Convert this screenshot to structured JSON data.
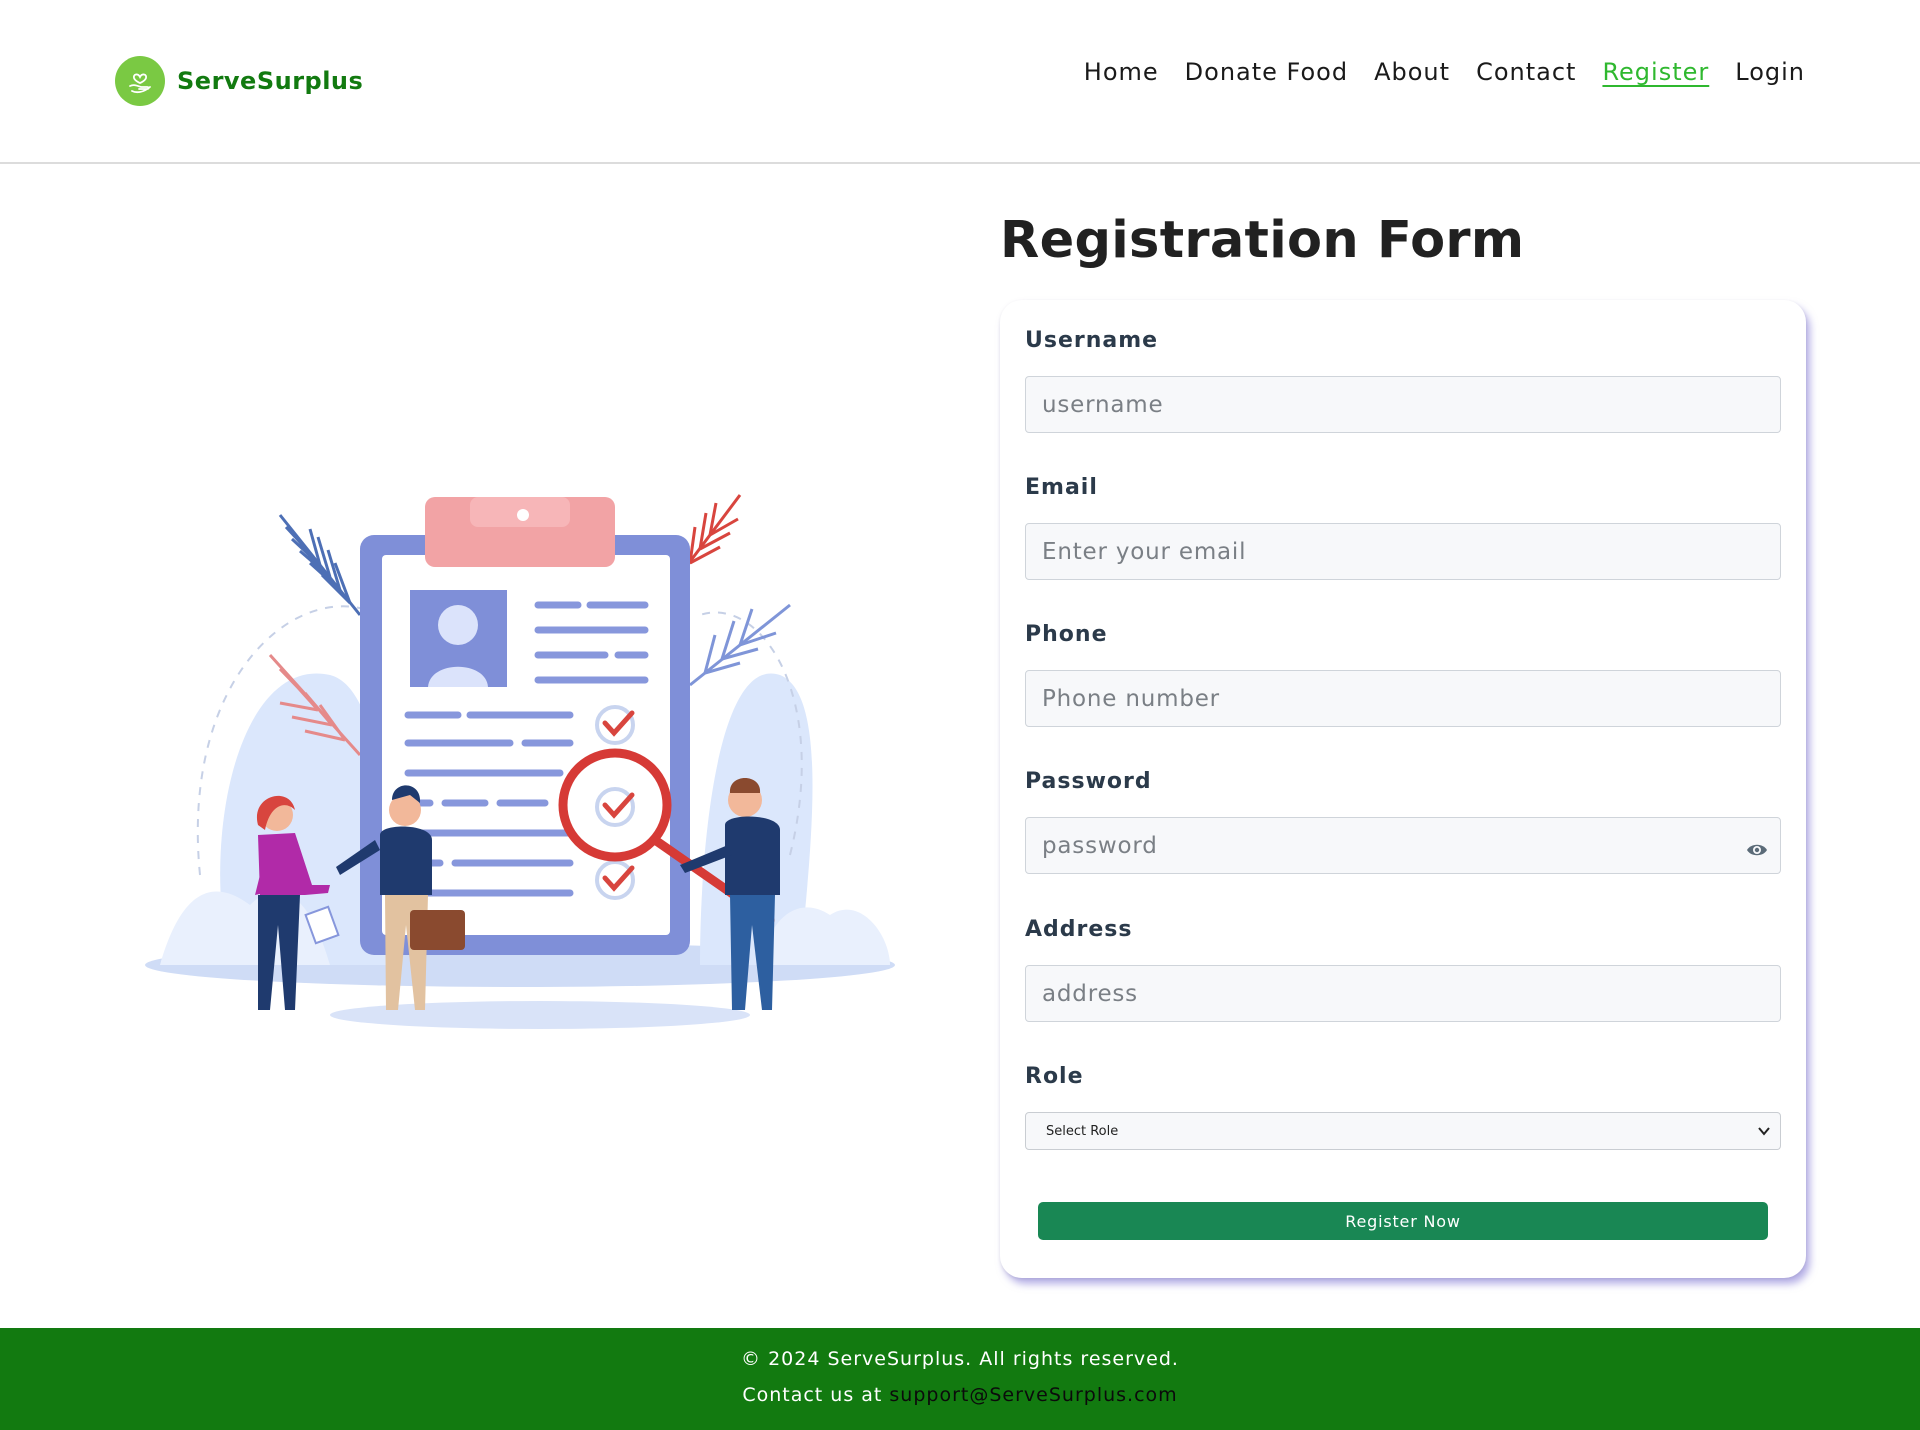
{
  "brand": {
    "name": "ServeSurplus",
    "color": "#127a10",
    "logo_bg": "#7ac943",
    "logo_icon": "heart-in-hand-icon"
  },
  "nav": {
    "items": [
      {
        "label": "Home",
        "active": false
      },
      {
        "label": "Donate Food",
        "active": false
      },
      {
        "label": "About",
        "active": false
      },
      {
        "label": "Contact",
        "active": false
      },
      {
        "label": "Register",
        "active": true
      },
      {
        "label": "Login",
        "active": false
      }
    ],
    "active_color": "#2fb82f"
  },
  "form": {
    "title": "Registration Form",
    "fields": {
      "username": {
        "label": "Username",
        "placeholder": "username"
      },
      "email": {
        "label": "Email",
        "placeholder": "Enter your email"
      },
      "phone": {
        "label": "Phone",
        "placeholder": "Phone number"
      },
      "password": {
        "label": "Password",
        "placeholder": "password",
        "toggle_icon": "eye-icon"
      },
      "address": {
        "label": "Address",
        "placeholder": "address"
      },
      "role": {
        "label": "Role",
        "selected": "Select Role"
      }
    },
    "submit_label": "Register Now",
    "submit_color": "#198754"
  },
  "footer": {
    "copyright": "© 2024 ServeSurplus. All rights reserved.",
    "contact_prefix": "Contact us at",
    "contact_email": "support@ServeSurplus.com",
    "bg": "#127a10"
  }
}
